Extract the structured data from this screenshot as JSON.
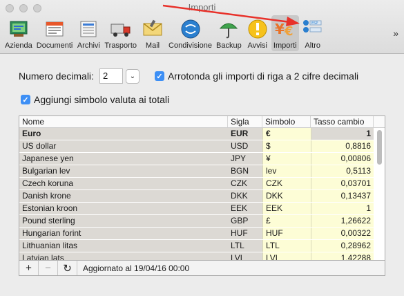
{
  "window": {
    "title": "Importi"
  },
  "toolbar": {
    "items": [
      {
        "label": "Azienda",
        "icon": "company-icon"
      },
      {
        "label": "Documenti",
        "icon": "documents-icon"
      },
      {
        "label": "Archivi",
        "icon": "archives-icon"
      },
      {
        "label": "Trasporto",
        "icon": "truck-icon"
      },
      {
        "label": "Mail",
        "icon": "mail-icon"
      },
      {
        "label": "Condivisione",
        "icon": "sharing-icon"
      },
      {
        "label": "Backup",
        "icon": "umbrella-icon"
      },
      {
        "label": "Avvisi",
        "icon": "warning-icon"
      },
      {
        "label": "Importi",
        "icon": "currency-icon",
        "active": true
      },
      {
        "label": "Altro",
        "icon": "more-icon"
      }
    ],
    "more_chevron": "»",
    "altro_icon_text": "ESP"
  },
  "settings": {
    "decimals_label": "Numero decimali:",
    "decimals_value": "2",
    "round_label": "Arrotonda gli importi di riga a 2 cifre decimali",
    "round_checked": true,
    "currency_symbol_label": "Aggiungi simbolo valuta ai totali",
    "currency_symbol_checked": true
  },
  "table": {
    "headers": {
      "name": "Nome",
      "sigla": "Sigla",
      "simbolo": "Simbolo",
      "tasso": "Tasso cambio"
    },
    "rows": [
      {
        "name": "Euro",
        "sigla": "EUR",
        "simbolo": "€",
        "tasso": "1",
        "bold": true
      },
      {
        "name": "US dollar",
        "sigla": "USD",
        "simbolo": "$",
        "tasso": "0,8816"
      },
      {
        "name": "Japanese yen",
        "sigla": "JPY",
        "simbolo": "¥",
        "tasso": "0,00806"
      },
      {
        "name": "Bulgarian lev",
        "sigla": "BGN",
        "simbolo": "lev",
        "tasso": "0,5113"
      },
      {
        "name": "Czech koruna",
        "sigla": "CZK",
        "simbolo": "CZK",
        "tasso": "0,03701"
      },
      {
        "name": "Danish krone",
        "sigla": "DKK",
        "simbolo": "DKK",
        "tasso": "0,13437"
      },
      {
        "name": "Estonian kroon",
        "sigla": "EEK",
        "simbolo": "EEK",
        "tasso": "1"
      },
      {
        "name": "Pound sterling",
        "sigla": "GBP",
        "simbolo": "£",
        "tasso": "1,26622"
      },
      {
        "name": "Hungarian forint",
        "sigla": "HUF",
        "simbolo": "HUF",
        "tasso": "0,00322"
      },
      {
        "name": "Lithuanian litas",
        "sigla": "LTL",
        "simbolo": "LTL",
        "tasso": "0,28962"
      },
      {
        "name": "Latvian lats",
        "sigla": "LVL",
        "simbolo": "LVL",
        "tasso": "1,42288"
      }
    ]
  },
  "bottom_bar": {
    "add_label": "+",
    "remove_label": "−",
    "refresh_label": "↻",
    "status": "Aggiornato al 19/04/16 00:00"
  },
  "colors": {
    "accent": "#3d8ff5",
    "annotation_arrow": "#e8312a",
    "symbol_column_bg": "#fdfdd6",
    "readonly_column_bg": "#dcd9d4"
  }
}
